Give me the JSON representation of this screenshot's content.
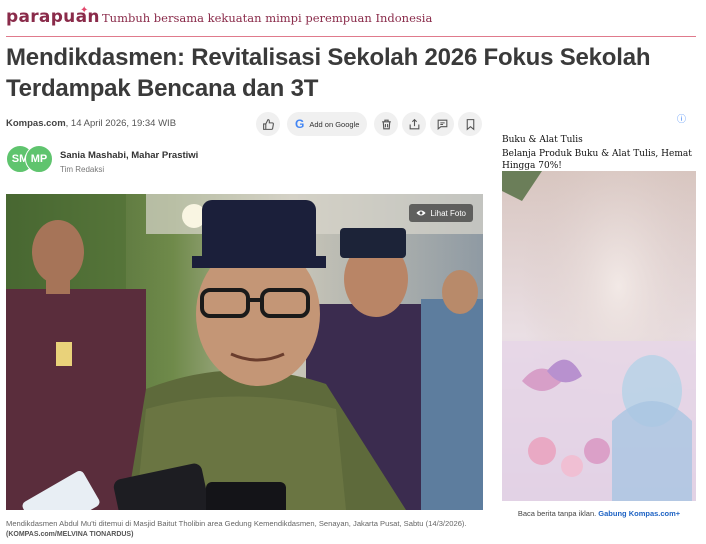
{
  "brand": {
    "logo": "parapuan",
    "tagline": "Tumbuh bersama kekuatan mimpi perempuan Indonesia"
  },
  "article": {
    "title": "Mendikdasmen: Revitalisasi Sekolah 2026 Fokus Sekolah Terdampak Bencana dan 3T",
    "source": "Kompas.com",
    "date": ", 14 April 2026, 19:34 WIB",
    "authors": "Sania Mashabi,  Mahar Prastiwi",
    "team": "Tim Redaksi",
    "avatar_initials": [
      "SM",
      "MP"
    ],
    "photo_button": "Lihat Foto",
    "caption": "Mendikdasmen Abdul Mu'ti ditemui di Masjid Baitut Tholibin area Gedung Kemendikdasmen, Senayan, Jakarta Pusat, Sabtu (14/3/2026).",
    "credit": "(KOMPAS.com/MELVINA TIONARDUS)"
  },
  "actions": {
    "google_label": "Add on Google",
    "icons": [
      "thumbs-up-icon",
      "google-icon",
      "trash-icon",
      "share-icon",
      "comment-icon",
      "bookmark-icon"
    ]
  },
  "ad": {
    "title": "Buku & Alat Tulis",
    "description": "Belanja Produk Buku & Alat Tulis, Hemat Hingga 70%!",
    "footer_text": "Baca berita tanpa iklan.",
    "footer_link": "Gabung Kompas.com+"
  },
  "colors": {
    "brand": "#8a2b4a",
    "rule": "#e07a8c",
    "avatar": "#5fc46e",
    "link": "#1e63c4"
  }
}
